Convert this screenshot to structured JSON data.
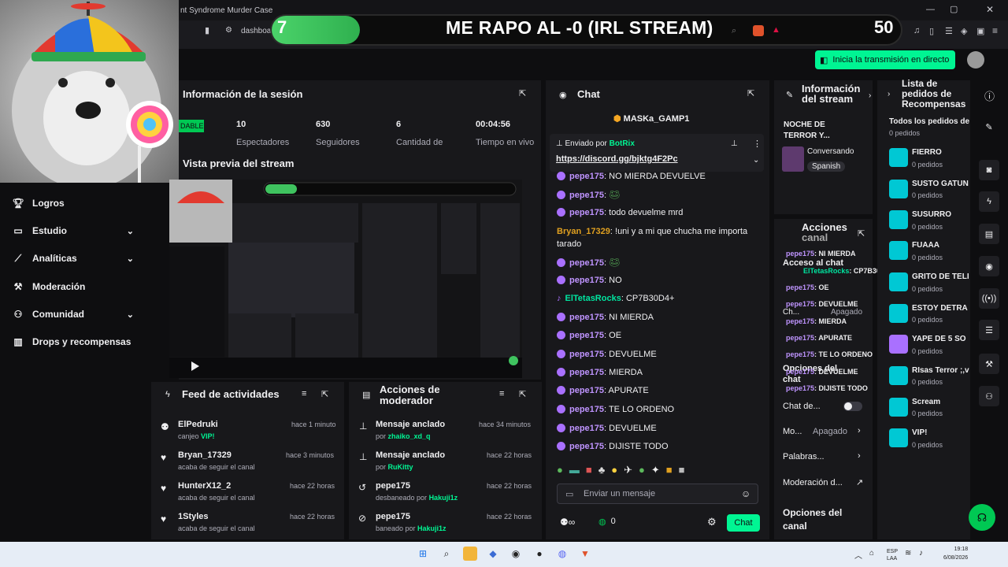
{
  "browser": {
    "tab_title": "nt Syndrome Murder Case",
    "url_partial": "dashboa"
  },
  "overlay": {
    "left_number": "7",
    "title": "ME RAPO AL -0 (IRL STREAM)",
    "right_number": "50",
    "progress": 0.14
  },
  "header": {
    "go_live_label": "Inicia la transmisión en directo"
  },
  "sidebar": {
    "items": [
      {
        "label": "Logros",
        "icon": "trophy-icon"
      },
      {
        "label": "Estudio",
        "icon": "monitor-icon"
      },
      {
        "label": "Analíticas",
        "icon": "chart-icon"
      },
      {
        "label": "Moderación",
        "icon": "wrench-icon"
      },
      {
        "label": "Comunidad",
        "icon": "people-icon"
      },
      {
        "label": "Drops y recompensas",
        "icon": "bars-icon"
      }
    ]
  },
  "session": {
    "title": "Información de la sesión",
    "badge": "DABLE",
    "stats": [
      {
        "value": "10",
        "label": "Espectadores"
      },
      {
        "value": "630",
        "label": "Seguidores"
      },
      {
        "value": "6",
        "label": "Cantidad de"
      },
      {
        "value": "00:04:56",
        "label": "Tiempo en vivo"
      }
    ]
  },
  "preview": {
    "title": "Vista previa del stream"
  },
  "feed": {
    "title": "Feed de actividades",
    "items": [
      {
        "name": "ElPedruki",
        "sub_prefix": "canjeo ",
        "sub_highlight": "VIP!",
        "time": "hace 1 minuto",
        "icon": "reward-icon"
      },
      {
        "name": "Bryan_17329",
        "sub_prefix": "acaba de seguir el canal",
        "sub_highlight": "",
        "time": "hace 3 minutos",
        "icon": "heart-icon"
      },
      {
        "name": "HunterX12_2",
        "sub_prefix": "acaba de seguir el canal",
        "sub_highlight": "",
        "time": "hace 22 horas",
        "icon": "heart-icon"
      },
      {
        "name": "1Styles",
        "sub_prefix": "acaba de seguir el canal",
        "sub_highlight": "",
        "time": "hace 22 horas",
        "icon": "heart-icon"
      }
    ]
  },
  "mod_actions": {
    "title_line1": "Acciones de",
    "title_line2": "moderador",
    "items": [
      {
        "name": "Mensaje anclado",
        "sub_prefix": "por ",
        "sub_highlight": "zhaiko_xd_q",
        "time": "hace 34 minutos",
        "icon": "pin-icon"
      },
      {
        "name": "Mensaje anclado",
        "sub_prefix": "por ",
        "sub_highlight": "RuKitty",
        "time": "hace 22 horas",
        "icon": "pin-icon"
      },
      {
        "name": "pepe175",
        "sub_prefix": "desbaneado por ",
        "sub_highlight": "Hakuji1z",
        "time": "hace 22 horas",
        "icon": "undo-icon"
      },
      {
        "name": "pepe175",
        "sub_prefix": "baneado por ",
        "sub_highlight": "Hakuji1z",
        "time": "hace 22 horas",
        "icon": "ban-icon"
      }
    ]
  },
  "chat": {
    "title": "Chat",
    "top_gifter": "MASKa_GAMP1",
    "pinned_by_label": "Enviado por",
    "pinned_by_user": "BotRix",
    "pinned_link": "https://discord.gg/bjktg4F2Pc",
    "messages": [
      {
        "user": "pepe175",
        "text": " NO MIERDA DEVUELVE",
        "color": "#bf94ff"
      },
      {
        "user": "pepe175",
        "text": "",
        "color": "#bf94ff"
      },
      {
        "user": "pepe175",
        "text": " todo devuelme mrd",
        "color": "#bf94ff"
      },
      {
        "user": "Bryan_17329",
        "text": " !uni y a mi que chucha me importa",
        "color": "#e0a020"
      },
      {
        "user": "",
        "text": "tarado",
        "color": "#efeff1"
      },
      {
        "user": "pepe175",
        "text": "",
        "color": "#bf94ff"
      },
      {
        "user": "pepe175",
        "text": " NO",
        "color": "#bf94ff"
      },
      {
        "user": "ElTetasRocks",
        "text": " CP7B30D4+",
        "color": "#00e5a0"
      },
      {
        "user": "pepe175",
        "text": " NI MIERDA",
        "color": "#bf94ff"
      },
      {
        "user": "pepe175",
        "text": " OE",
        "color": "#bf94ff"
      },
      {
        "user": "pepe175",
        "text": " DEVUELME",
        "color": "#bf94ff"
      },
      {
        "user": "pepe175",
        "text": " MIERDA",
        "color": "#bf94ff"
      },
      {
        "user": "pepe175",
        "text": " APURATE",
        "color": "#bf94ff"
      },
      {
        "user": "pepe175",
        "text": " TE LO ORDENO",
        "color": "#bf94ff"
      },
      {
        "user": "pepe175",
        "text": " DEVUELME",
        "color": "#bf94ff"
      },
      {
        "user": "pepe175",
        "text": " DIJISTE TODO",
        "color": "#bf94ff"
      }
    ],
    "input_placeholder": "Enviar un mensaje",
    "points": "0",
    "send_label": "Chat"
  },
  "stream_info": {
    "title_line1": "Información",
    "title_line2": "del stream",
    "stream_title_line1": "NOCHE DE",
    "stream_title_line2": "TERROR Y...",
    "category": "Conversando",
    "language": "Spanish"
  },
  "quick_actions": {
    "title_line1": "Acciones",
    "title_line2": "canal",
    "overlay_labels": [
      "Acceso al chat",
      "Ch...",
      "Opciones del",
      "chat"
    ],
    "apagado": "Apagado",
    "chat_de": "Chat de...",
    "mo_label": "Mo...",
    "mo_value": "Apagado",
    "palabras": "Palabras...",
    "moderacion": "Moderación d...",
    "opciones_canal_1": "Opciones del",
    "opciones_canal_2": "canal"
  },
  "mod_overlay_msgs": [
    {
      "user": "pepe175",
      "text": "NI MIERDA"
    },
    {
      "user": "ElTetasRocks",
      "text": "CP7B30D4+"
    },
    {
      "user": "pepe175",
      "text": "OE"
    },
    {
      "user": "pepe175",
      "text": "DEVUELME"
    },
    {
      "user": "pepe175",
      "text": "MIERDA"
    },
    {
      "user": "pepe175",
      "text": "APURATE"
    },
    {
      "user": "pepe175",
      "text": "TE LO ORDENO"
    },
    {
      "user": "pepe175",
      "text": "DEVUELME"
    },
    {
      "user": "pepe175",
      "text": "DIJISTE TODO"
    }
  ],
  "rewards": {
    "title_line1": "Lista de",
    "title_line2": "pedidos de",
    "title_line3": "Recompensas",
    "tab": "Todos los pedidos de",
    "tab_sub": "0 pedidos",
    "items": [
      {
        "name": "FIERRO",
        "sub": "0 pedidos",
        "color": "#00c8d4"
      },
      {
        "name": "SUSTO GATUN",
        "sub": "0 pedidos",
        "color": "#00c8d4"
      },
      {
        "name": "SUSURRO",
        "sub": "0 pedidos",
        "color": "#00c8d4"
      },
      {
        "name": "FUAAA",
        "sub": "0 pedidos",
        "color": "#00c8d4"
      },
      {
        "name": "GRITO DE TELI",
        "sub": "0 pedidos",
        "color": "#00c8d4"
      },
      {
        "name": "ESTOY DETRA",
        "sub": "0 pedidos",
        "color": "#00c8d4"
      },
      {
        "name": "YAPE DE 5 SO",
        "sub": "0 pedidos",
        "color": "#a970ff"
      },
      {
        "name": "RIsas Terror ;,v",
        "sub": "0 pedidos",
        "color": "#00c8d4"
      },
      {
        "name": "Scream",
        "sub": "0 pedidos",
        "color": "#00c8d4"
      },
      {
        "name": "VIP!",
        "sub": "0 pedidos",
        "color": "#00c8d4"
      }
    ]
  },
  "taskbar": {
    "lang_line1": "ESP",
    "lang_line2": "LAA",
    "time": "19:18",
    "date": "6/08/2026"
  },
  "colors": {
    "accent_green": "#00f593",
    "twitch_purple": "#a970ff",
    "panel_bg": "#18181b",
    "page_bg": "#0e0e10"
  }
}
